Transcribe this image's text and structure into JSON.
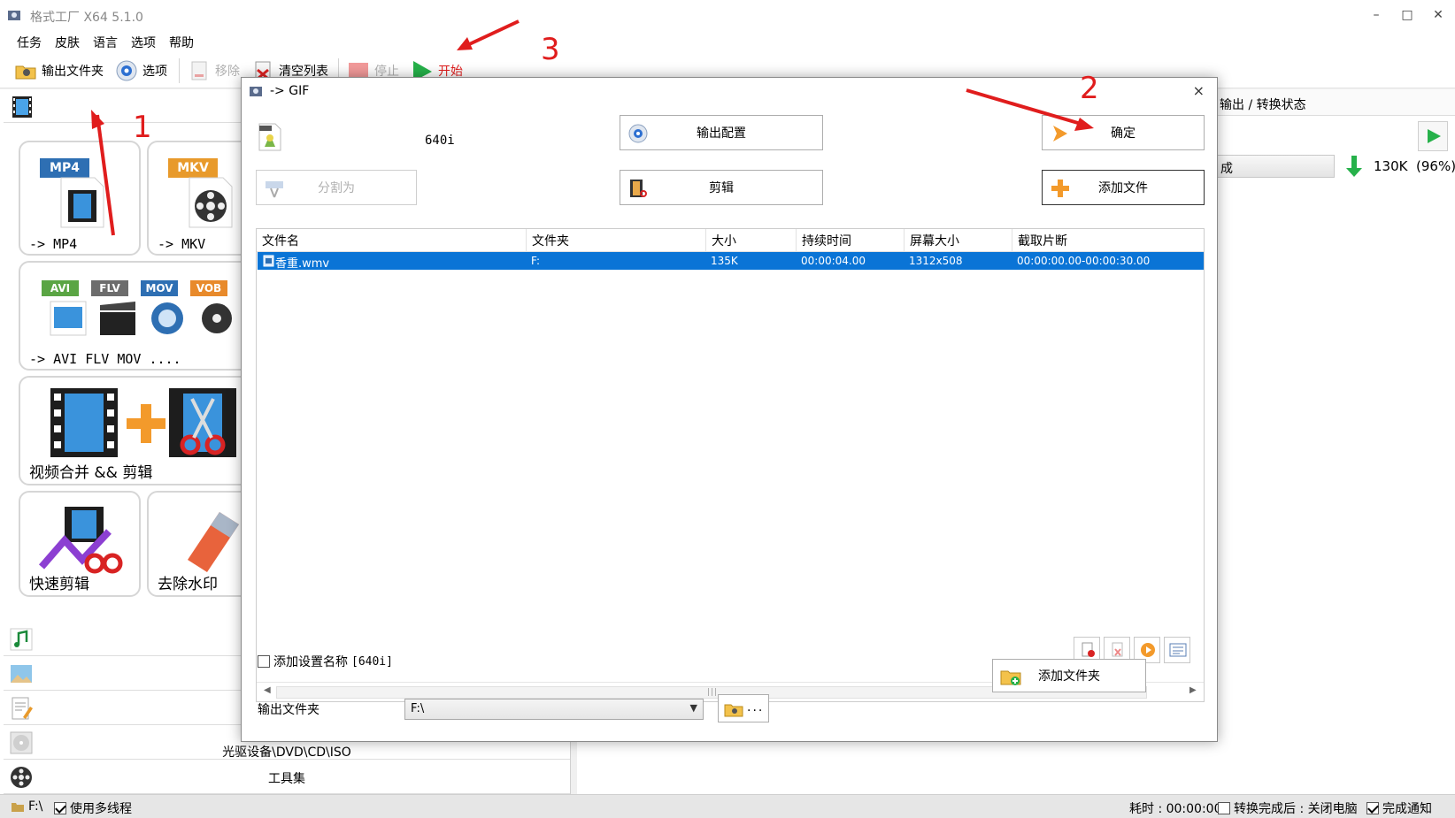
{
  "window": {
    "title": "格式工厂 X64 5.1.0",
    "minimize": "–",
    "maximize": "□",
    "close": "✕"
  },
  "menu": [
    "任务",
    "皮肤",
    "语言",
    "选项",
    "帮助"
  ],
  "toolbar": {
    "output_folder": "输出文件夹",
    "options": "选项",
    "remove": "移除",
    "clear_list": "清空列表",
    "stop": "停止",
    "start": "开始"
  },
  "left_panel": {
    "tiles": {
      "mp4": {
        "badge": "MP4",
        "caption": "-> MP4"
      },
      "mkv": {
        "badge": "MKV",
        "caption": "-> MKV"
      },
      "multi": {
        "badges": [
          "AVI",
          "FLV",
          "MOV",
          "VOB"
        ],
        "caption": "-> AVI FLV MOV ...."
      },
      "merge": {
        "caption": "视频合并 && 剪辑"
      },
      "quick_edit": {
        "caption": "快速剪辑"
      },
      "watermark": {
        "caption": "去除水印"
      }
    },
    "categories": {
      "disc": "光驱设备\\DVD\\CD\\ISO",
      "tools": "工具集"
    }
  },
  "right_panel": {
    "header": "输出 / 转换状态",
    "status_text": "成",
    "size_text": "130K",
    "percent_text": "(96%)"
  },
  "statusbar": {
    "drive": "F:\\",
    "multithread": "使用多线程",
    "elapsed": "耗时 : 00:00:00",
    "after_convert": "转换完成后 : 关闭电脑",
    "notify": "完成通知"
  },
  "dialog": {
    "title": "-> GIF",
    "close": "×",
    "preset": "640i",
    "output_config": "输出配置",
    "ok": "确定",
    "split": "分割为",
    "edit": "剪辑",
    "add_file": "添加文件",
    "columns": [
      "文件名",
      "文件夹",
      "大小",
      "持续时间",
      "屏幕大小",
      "截取片断"
    ],
    "rows": [
      {
        "name": "香重.wmv",
        "folder": "F:",
        "size": "135K",
        "duration": "00:00:04.00",
        "screen": "1312x508",
        "clip": "00:00:00.00-00:00:30.00"
      }
    ],
    "add_setting_name": "添加设置名称",
    "add_setting_value": "[640i]",
    "output_folder_label": "输出文件夹",
    "output_folder_value": "F:\\",
    "browse_dots": "...",
    "add_folder": "添加文件夹"
  },
  "annotations": [
    "1",
    "2",
    "3"
  ],
  "colors": {
    "selection": "#0a74d6",
    "annotation": "#e01d1d",
    "start_green": "#26b14a",
    "mp4_badge": "#2e6fb3",
    "mkv_badge": "#e89a2b"
  }
}
